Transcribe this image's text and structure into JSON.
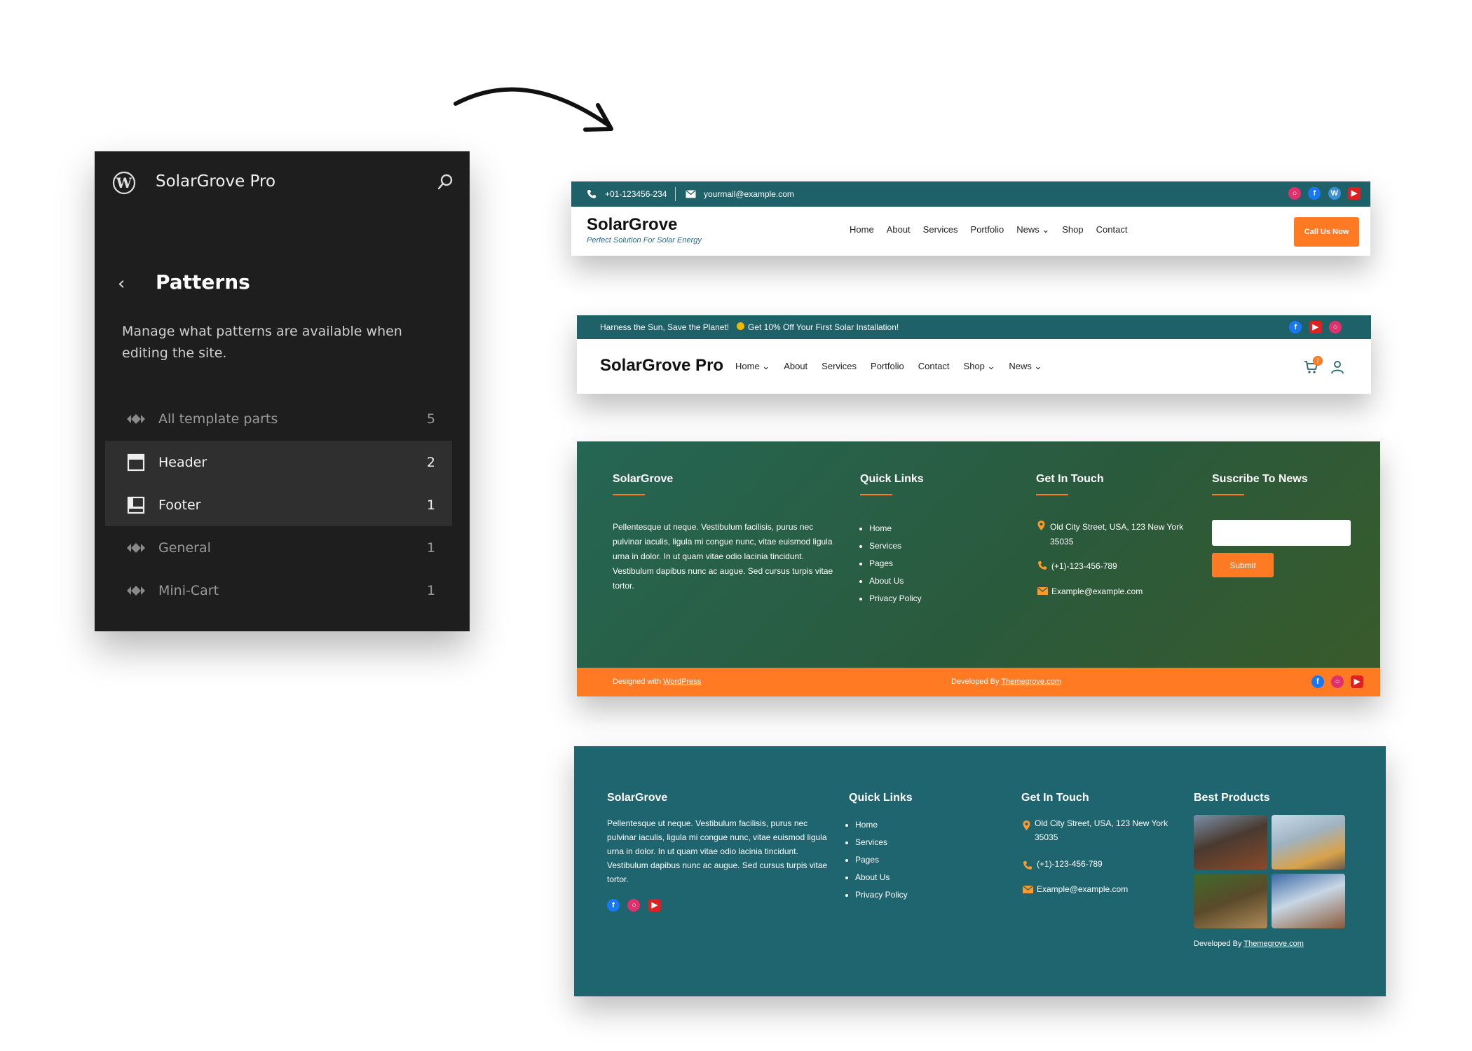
{
  "wp_panel": {
    "site_title": "SolarGrove Pro",
    "title": "Patterns",
    "description": "Manage what patterns are available when editing the site.",
    "items": [
      {
        "label": "All template parts",
        "count": "5",
        "icon": "diamond-icon"
      },
      {
        "label": "Header",
        "count": "2",
        "icon": "header-layout-icon"
      },
      {
        "label": "Footer",
        "count": "1",
        "icon": "footer-layout-icon"
      },
      {
        "label": "General",
        "count": "1",
        "icon": "diamond-icon"
      },
      {
        "label": "Mini-Cart",
        "count": "1",
        "icon": "diamond-icon"
      }
    ]
  },
  "header1": {
    "phone": "+01-123456-234",
    "email": "yourmail@example.com",
    "brand": "SolarGrove",
    "tagline": "Perfect Solution For Solar Energy",
    "nav": [
      "Home",
      "About",
      "Services",
      "Portfolio",
      "News ⌄",
      "Shop",
      "Contact"
    ],
    "cta": "Call Us Now"
  },
  "header2": {
    "announcement_a": "Harness the Sun, Save the Planet!",
    "announcement_b": "Get 10% Off Your First Solar Installation!",
    "brand": "SolarGrove Pro",
    "nav": [
      "Home ⌄",
      "About",
      "Services",
      "Portfolio",
      "Contact",
      "Shop ⌄",
      "News ⌄"
    ],
    "cart_count": "7"
  },
  "footer1": {
    "col1_title": "SolarGrove",
    "about": "Pellentesque ut neque. Vestibulum facilisis, purus nec pulvinar iaculis, ligula mi congue nunc, vitae euismod ligula urna in dolor. In ut quam vitae odio lacinia tincidunt. Vestibulum dapibus nunc ac augue. Sed cursus turpis vitae tortor.",
    "col2_title": "Quick Links",
    "links": [
      "Home",
      "Services",
      "Pages",
      "About Us",
      "Privacy Policy"
    ],
    "col3_title": "Get In Touch",
    "address": "Old City Street, USA, 123 New York 35035",
    "phone": "(+1)-123-456-789",
    "email": "Example@example.com",
    "col4_title": "Suscribe To News",
    "submit": "Submit",
    "designed_prefix": "Designed with ",
    "designed_link": "WordPress",
    "developed_prefix": "Developed By ",
    "developed_link": "Themegrove.com"
  },
  "footer2": {
    "col1_title": "SolarGrove",
    "about": "Pellentesque ut neque. Vestibulum facilisis, purus nec pulvinar iaculis, ligula mi congue nunc, vitae euismod ligula urna in dolor. In ut quam vitae odio lacinia tincidunt. Vestibulum dapibus nunc ac augue. Sed cursus turpis vitae tortor.",
    "col2_title": "Quick Links",
    "links": [
      "Home",
      "Services",
      "Pages",
      "About Us",
      "Privacy Policy"
    ],
    "col3_title": "Get In Touch",
    "address": "Old City Street, USA, 123 New York 35035",
    "phone": "(+1)-123-456-789",
    "email": "Example@example.com",
    "col4_title": "Best Products",
    "developed_prefix": "Developed By ",
    "developed_link": "Themegrove.com"
  },
  "colors": {
    "teal": "#1f6168",
    "orange": "#ff7a22",
    "panel_bg": "#1e1e1e"
  }
}
